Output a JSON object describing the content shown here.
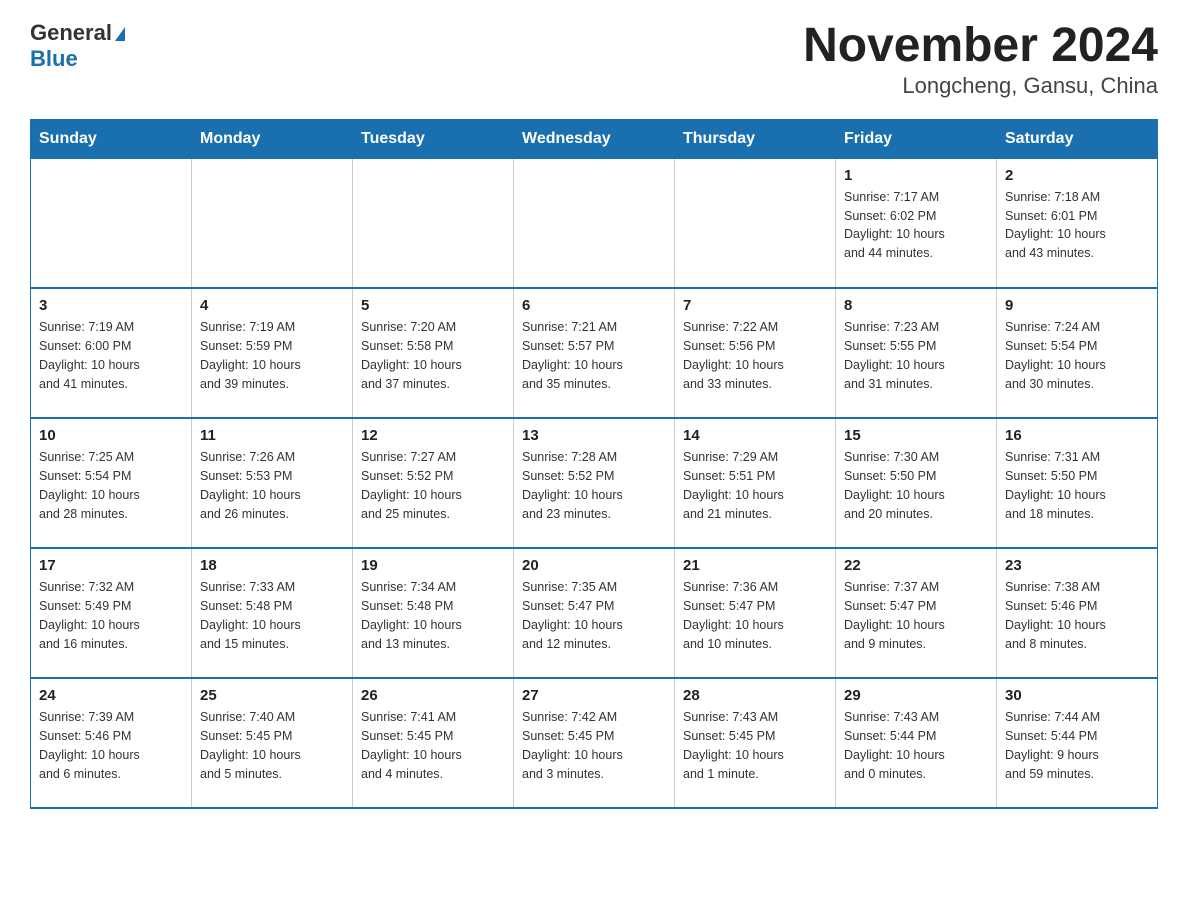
{
  "header": {
    "logo_general": "General",
    "logo_blue": "Blue",
    "title": "November 2024",
    "subtitle": "Longcheng, Gansu, China"
  },
  "days_of_week": [
    "Sunday",
    "Monday",
    "Tuesday",
    "Wednesday",
    "Thursday",
    "Friday",
    "Saturday"
  ],
  "weeks": [
    {
      "days": [
        {
          "num": "",
          "info": ""
        },
        {
          "num": "",
          "info": ""
        },
        {
          "num": "",
          "info": ""
        },
        {
          "num": "",
          "info": ""
        },
        {
          "num": "",
          "info": ""
        },
        {
          "num": "1",
          "info": "Sunrise: 7:17 AM\nSunset: 6:02 PM\nDaylight: 10 hours\nand 44 minutes."
        },
        {
          "num": "2",
          "info": "Sunrise: 7:18 AM\nSunset: 6:01 PM\nDaylight: 10 hours\nand 43 minutes."
        }
      ]
    },
    {
      "days": [
        {
          "num": "3",
          "info": "Sunrise: 7:19 AM\nSunset: 6:00 PM\nDaylight: 10 hours\nand 41 minutes."
        },
        {
          "num": "4",
          "info": "Sunrise: 7:19 AM\nSunset: 5:59 PM\nDaylight: 10 hours\nand 39 minutes."
        },
        {
          "num": "5",
          "info": "Sunrise: 7:20 AM\nSunset: 5:58 PM\nDaylight: 10 hours\nand 37 minutes."
        },
        {
          "num": "6",
          "info": "Sunrise: 7:21 AM\nSunset: 5:57 PM\nDaylight: 10 hours\nand 35 minutes."
        },
        {
          "num": "7",
          "info": "Sunrise: 7:22 AM\nSunset: 5:56 PM\nDaylight: 10 hours\nand 33 minutes."
        },
        {
          "num": "8",
          "info": "Sunrise: 7:23 AM\nSunset: 5:55 PM\nDaylight: 10 hours\nand 31 minutes."
        },
        {
          "num": "9",
          "info": "Sunrise: 7:24 AM\nSunset: 5:54 PM\nDaylight: 10 hours\nand 30 minutes."
        }
      ]
    },
    {
      "days": [
        {
          "num": "10",
          "info": "Sunrise: 7:25 AM\nSunset: 5:54 PM\nDaylight: 10 hours\nand 28 minutes."
        },
        {
          "num": "11",
          "info": "Sunrise: 7:26 AM\nSunset: 5:53 PM\nDaylight: 10 hours\nand 26 minutes."
        },
        {
          "num": "12",
          "info": "Sunrise: 7:27 AM\nSunset: 5:52 PM\nDaylight: 10 hours\nand 25 minutes."
        },
        {
          "num": "13",
          "info": "Sunrise: 7:28 AM\nSunset: 5:52 PM\nDaylight: 10 hours\nand 23 minutes."
        },
        {
          "num": "14",
          "info": "Sunrise: 7:29 AM\nSunset: 5:51 PM\nDaylight: 10 hours\nand 21 minutes."
        },
        {
          "num": "15",
          "info": "Sunrise: 7:30 AM\nSunset: 5:50 PM\nDaylight: 10 hours\nand 20 minutes."
        },
        {
          "num": "16",
          "info": "Sunrise: 7:31 AM\nSunset: 5:50 PM\nDaylight: 10 hours\nand 18 minutes."
        }
      ]
    },
    {
      "days": [
        {
          "num": "17",
          "info": "Sunrise: 7:32 AM\nSunset: 5:49 PM\nDaylight: 10 hours\nand 16 minutes."
        },
        {
          "num": "18",
          "info": "Sunrise: 7:33 AM\nSunset: 5:48 PM\nDaylight: 10 hours\nand 15 minutes."
        },
        {
          "num": "19",
          "info": "Sunrise: 7:34 AM\nSunset: 5:48 PM\nDaylight: 10 hours\nand 13 minutes."
        },
        {
          "num": "20",
          "info": "Sunrise: 7:35 AM\nSunset: 5:47 PM\nDaylight: 10 hours\nand 12 minutes."
        },
        {
          "num": "21",
          "info": "Sunrise: 7:36 AM\nSunset: 5:47 PM\nDaylight: 10 hours\nand 10 minutes."
        },
        {
          "num": "22",
          "info": "Sunrise: 7:37 AM\nSunset: 5:47 PM\nDaylight: 10 hours\nand 9 minutes."
        },
        {
          "num": "23",
          "info": "Sunrise: 7:38 AM\nSunset: 5:46 PM\nDaylight: 10 hours\nand 8 minutes."
        }
      ]
    },
    {
      "days": [
        {
          "num": "24",
          "info": "Sunrise: 7:39 AM\nSunset: 5:46 PM\nDaylight: 10 hours\nand 6 minutes."
        },
        {
          "num": "25",
          "info": "Sunrise: 7:40 AM\nSunset: 5:45 PM\nDaylight: 10 hours\nand 5 minutes."
        },
        {
          "num": "26",
          "info": "Sunrise: 7:41 AM\nSunset: 5:45 PM\nDaylight: 10 hours\nand 4 minutes."
        },
        {
          "num": "27",
          "info": "Sunrise: 7:42 AM\nSunset: 5:45 PM\nDaylight: 10 hours\nand 3 minutes."
        },
        {
          "num": "28",
          "info": "Sunrise: 7:43 AM\nSunset: 5:45 PM\nDaylight: 10 hours\nand 1 minute."
        },
        {
          "num": "29",
          "info": "Sunrise: 7:43 AM\nSunset: 5:44 PM\nDaylight: 10 hours\nand 0 minutes."
        },
        {
          "num": "30",
          "info": "Sunrise: 7:44 AM\nSunset: 5:44 PM\nDaylight: 9 hours\nand 59 minutes."
        }
      ]
    }
  ]
}
